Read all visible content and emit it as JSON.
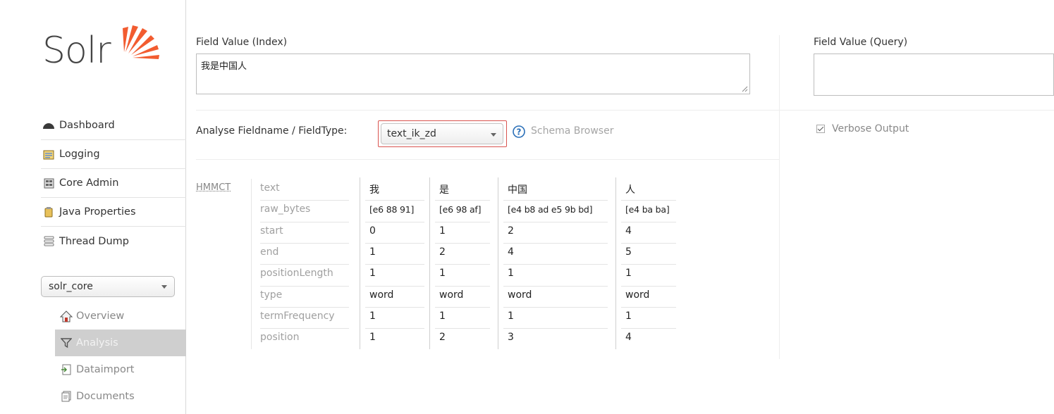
{
  "app": {
    "logo_text": "Solr"
  },
  "sidebar": {
    "nav": [
      {
        "label": "Dashboard",
        "icon": "dashboard-icon"
      },
      {
        "label": "Logging",
        "icon": "logging-icon"
      },
      {
        "label": "Core Admin",
        "icon": "core-admin-icon"
      },
      {
        "label": "Java Properties",
        "icon": "java-properties-icon"
      },
      {
        "label": "Thread Dump",
        "icon": "thread-dump-icon"
      }
    ],
    "core_selector": {
      "value": "solr_core"
    },
    "core_menu": [
      {
        "label": "Overview",
        "icon": "home-icon"
      },
      {
        "label": "Analysis",
        "icon": "filter-icon",
        "active": true
      },
      {
        "label": "Dataimport",
        "icon": "dataimport-icon"
      },
      {
        "label": "Documents",
        "icon": "documents-icon"
      }
    ]
  },
  "analysis": {
    "index_label": "Field Value (Index)",
    "index_value": "我是中国人",
    "query_label": "Field Value (Query)",
    "query_value": "",
    "fieldtype_label": "Analyse Fieldname / FieldType:",
    "fieldtype_value": "text_ik_zd",
    "schema_browser_label": "Schema Browser",
    "verbose_label": "Verbose Output",
    "verbose_checked": true,
    "analyzer": "HMMCT",
    "attributes": [
      "text",
      "raw_bytes",
      "start",
      "end",
      "positionLength",
      "type",
      "termFrequency",
      "position"
    ],
    "tokens": [
      {
        "text": "我",
        "raw_bytes": "[e6 88 91]",
        "start": "0",
        "end": "1",
        "positionLength": "1",
        "type": "word",
        "termFrequency": "1",
        "position": "1"
      },
      {
        "text": "是",
        "raw_bytes": "[e6 98 af]",
        "start": "1",
        "end": "2",
        "positionLength": "1",
        "type": "word",
        "termFrequency": "1",
        "position": "2"
      },
      {
        "text": "中国",
        "raw_bytes": "[e4 b8 ad e5 9b bd]",
        "start": "2",
        "end": "4",
        "positionLength": "1",
        "type": "word",
        "termFrequency": "1",
        "position": "3"
      },
      {
        "text": "人",
        "raw_bytes": "[e4 ba ba]",
        "start": "4",
        "end": "5",
        "positionLength": "1",
        "type": "word",
        "termFrequency": "1",
        "position": "4"
      }
    ]
  },
  "colors": {
    "highlight_border": "#d9534f",
    "logo_flame": "#f25c30",
    "active_bg": "#cfcfcf"
  }
}
